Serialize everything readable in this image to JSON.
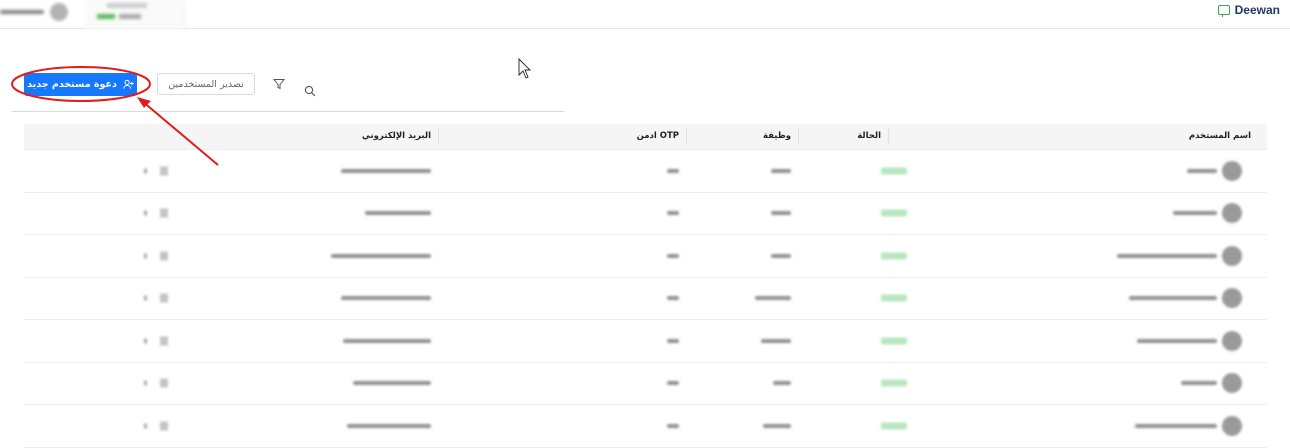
{
  "header": {
    "brand_name": "Deewan",
    "brand_color": "#1e3a5f",
    "brand_icon": "chat-monitor-icon"
  },
  "toolbar": {
    "invite_label": "دعوة مستخدم جديد",
    "invite_icon": "user-add-icon",
    "export_label": "تصدير المستخدمين",
    "filter_icon": "filter-icon",
    "search_icon": "search-icon",
    "accent_color": "#1677ff"
  },
  "annotation": {
    "highlight_color": "#e31b1b",
    "target": "invite-button"
  },
  "table": {
    "columns": {
      "username": "اسم المستخدم",
      "status": "الحالة",
      "role": "وظيفة",
      "otp_admin": "OTP ادمن",
      "email": "البريد الإلكتروني"
    },
    "row_count": 7,
    "rows_blurred": true
  }
}
